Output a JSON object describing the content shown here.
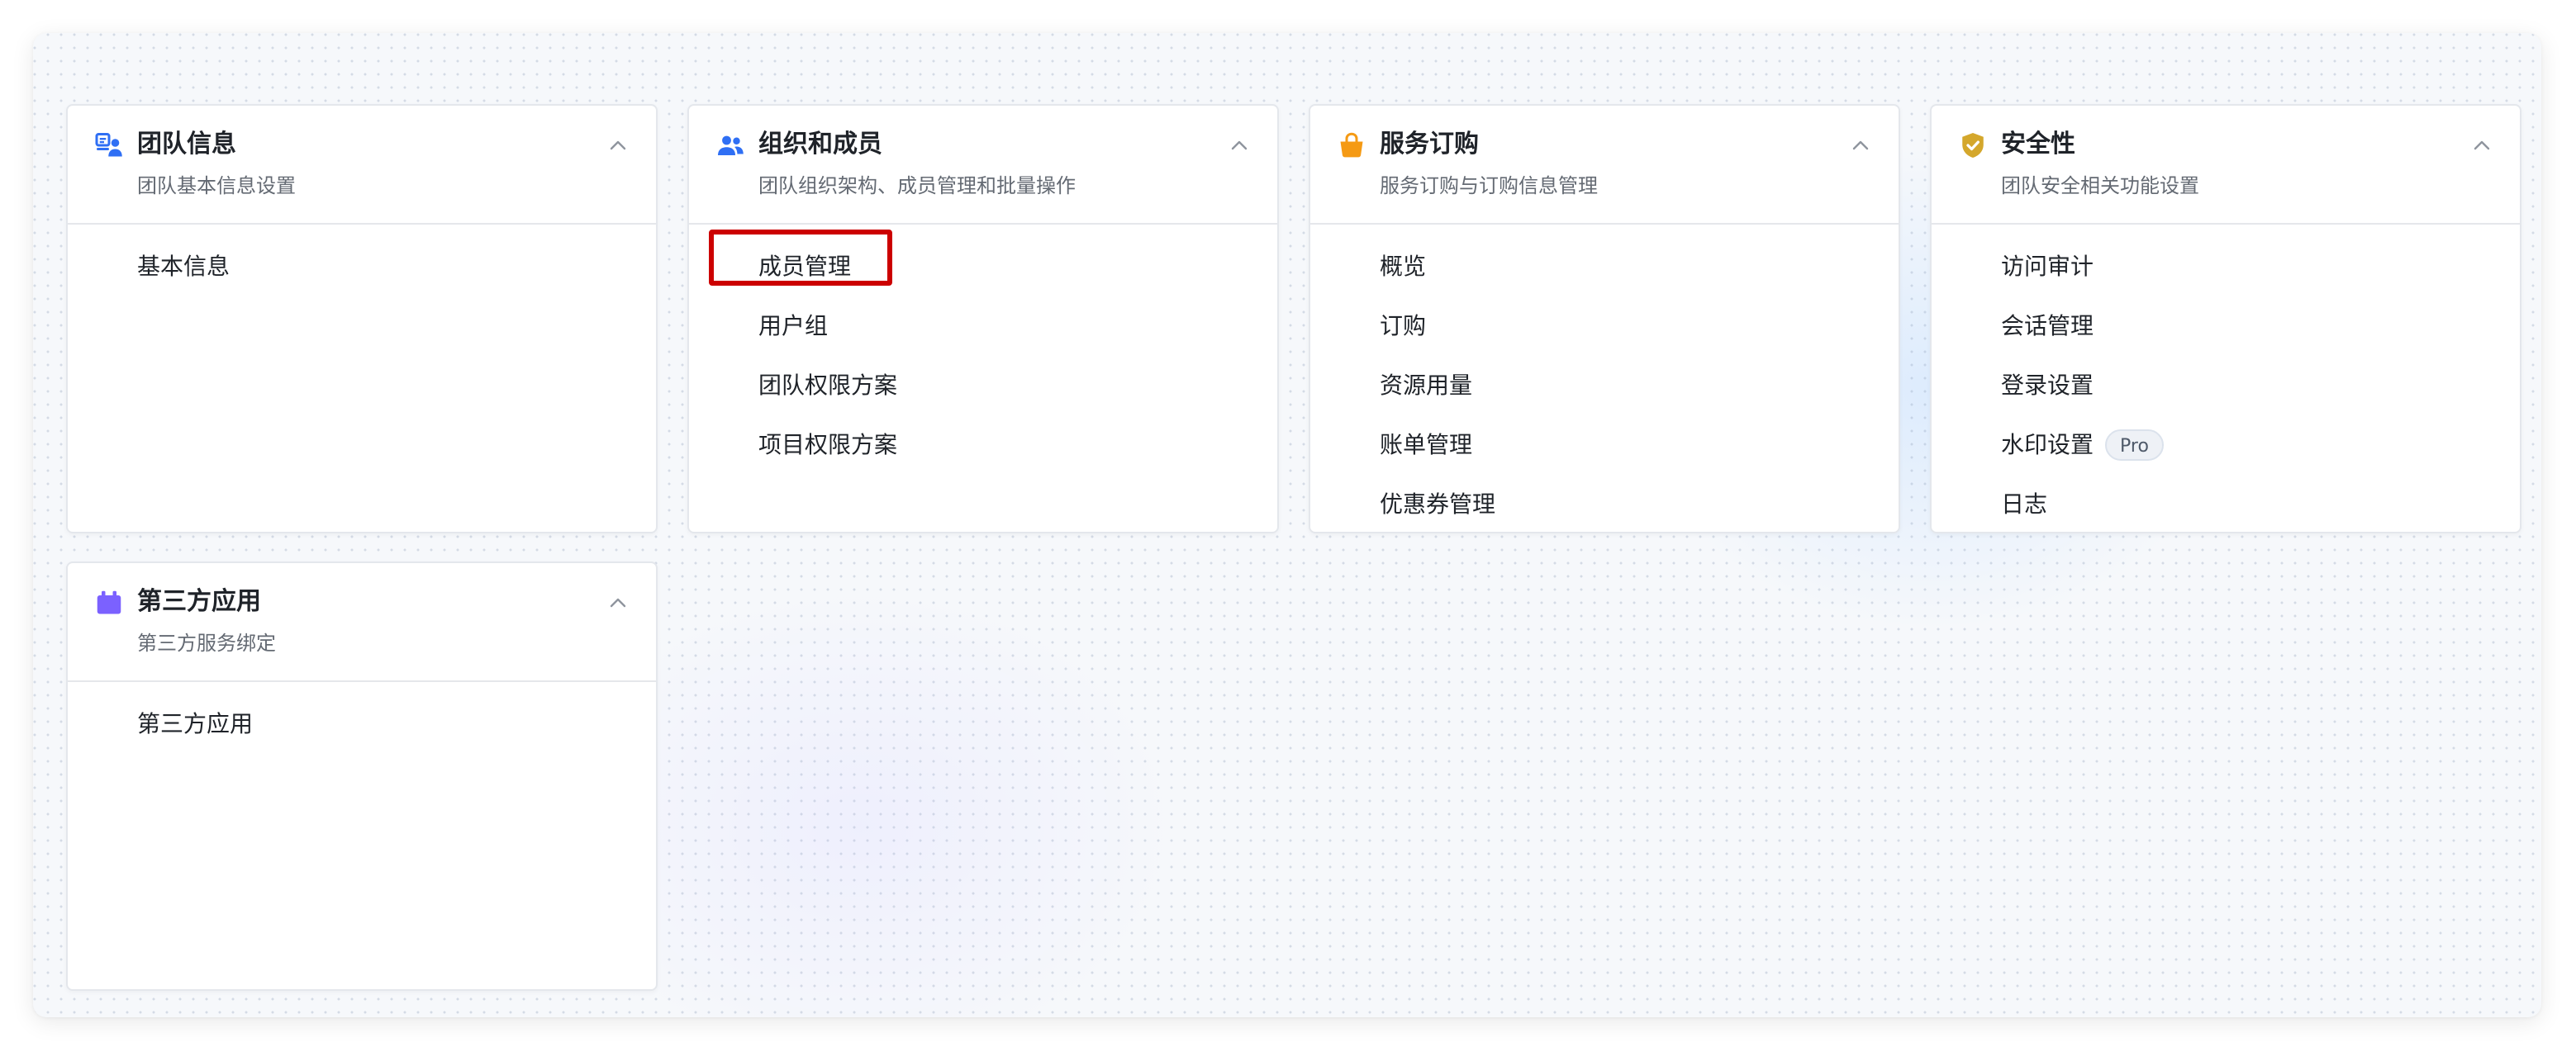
{
  "cards": [
    {
      "id": "team-info",
      "icon": "team-info-icon",
      "title": "团队信息",
      "subtitle": "团队基本信息设置",
      "items": [
        {
          "label": "基本信息"
        }
      ]
    },
    {
      "id": "org-members",
      "icon": "members-icon",
      "title": "组织和成员",
      "subtitle": "团队组织架构、成员管理和批量操作",
      "items": [
        {
          "label": "成员管理",
          "highlighted": true
        },
        {
          "label": "用户组"
        },
        {
          "label": "团队权限方案"
        },
        {
          "label": "项目权限方案"
        }
      ]
    },
    {
      "id": "subscription",
      "icon": "shopping-bag-icon",
      "title": "服务订购",
      "subtitle": "服务订购与订购信息管理",
      "items": [
        {
          "label": "概览"
        },
        {
          "label": "订购"
        },
        {
          "label": "资源用量"
        },
        {
          "label": "账单管理"
        },
        {
          "label": "优惠券管理"
        }
      ]
    },
    {
      "id": "security",
      "icon": "shield-check-icon",
      "title": "安全性",
      "subtitle": "团队安全相关功能设置",
      "items": [
        {
          "label": "访问审计"
        },
        {
          "label": "会话管理"
        },
        {
          "label": "登录设置"
        },
        {
          "label": "水印设置",
          "badge": "Pro"
        },
        {
          "label": "日志"
        }
      ]
    },
    {
      "id": "third-party",
      "icon": "app-icon",
      "title": "第三方应用",
      "subtitle": "第三方服务绑定",
      "items": [
        {
          "label": "第三方应用"
        }
      ]
    }
  ],
  "colors": {
    "team_info_icon": "#2f6ff4",
    "members_icon": "#2f6ff4",
    "shopping_bag_icon": "#f59a14",
    "shield_check_icon": "#d4a72c",
    "app_icon": "#7b61ff",
    "highlight": "#cc0000"
  }
}
